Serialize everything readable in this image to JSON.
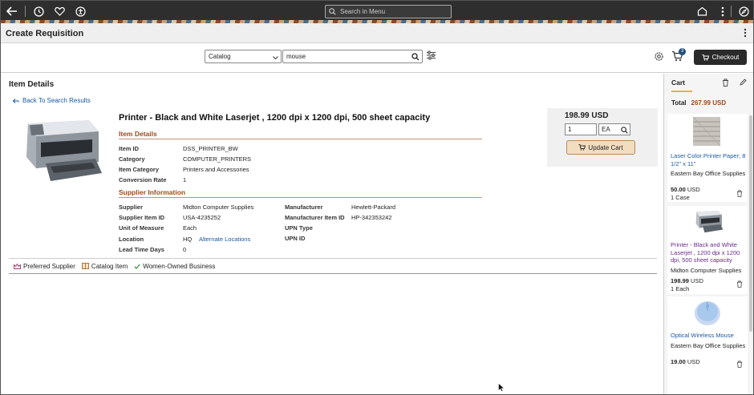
{
  "topbar": {
    "search_placeholder": "Search in Menu",
    "icons": [
      "back-arrow-icon",
      "history-icon",
      "favorite-heart-icon",
      "accessibility-icon",
      "home-icon",
      "more-vertical-icon",
      "navigator-compass-icon"
    ]
  },
  "titlebar": {
    "title": "Create Requisition"
  },
  "search": {
    "catalog_value": "Catalog",
    "query": "mouse",
    "cart_count": "3",
    "checkout_label": "Checkout"
  },
  "item": {
    "heading": "Item Details",
    "back_link": "Back To Search Results",
    "title": "Printer - Black and White Laserjet , 1200 dpi x 1200 dpi, 500 sheet capacity",
    "details_heading": "Item Details",
    "details": [
      {
        "label": "Item ID",
        "value": "DSS_PRINTER_BW"
      },
      {
        "label": "Category",
        "value": "COMPUTER_PRINTERS"
      },
      {
        "label": "Item Category",
        "value": "Printers and Accessories"
      },
      {
        "label": "Conversion Rate",
        "value": "1"
      }
    ],
    "supplier_heading": "Supplier Information",
    "supplier_left": [
      {
        "label": "Supplier",
        "value": "Midton Computer Supplies"
      },
      {
        "label": "Supplier Item ID",
        "value": "USA-4235252"
      },
      {
        "label": "Unit of Measure",
        "value": "Each"
      },
      {
        "label": "Location",
        "value": "HQ"
      },
      {
        "label": "Lead Time Days",
        "value": "0"
      }
    ],
    "alternate_locations": "Alternate Locations",
    "supplier_right": [
      {
        "label": "Manufacturer",
        "value": "Hewlett-Packard"
      },
      {
        "label": "Manufacturer Item ID",
        "value": "HP-342353242"
      },
      {
        "label": "UPN Type",
        "value": ""
      },
      {
        "label": "UPN ID",
        "value": ""
      }
    ],
    "price": "198.99 USD",
    "qty": "1",
    "uom": "EA",
    "update_label": "Update Cart",
    "legend": [
      "Preferred Supplier",
      "Catalog Item",
      "Women-Owned Business"
    ]
  },
  "cart": {
    "title": "Cart",
    "total_label": "Total",
    "total_amount": "267.99 USD",
    "items": [
      {
        "name": "Laser Color Printer Paper; 8 1/2\" x 11\"",
        "supplier": "Eastern Bay Office Supplies",
        "price": "50.00",
        "currency": "USD",
        "qty": "1 Case"
      },
      {
        "name": "Printer - Black and White Laserjet , 1200 dpi x 1200 dpi, 500 sheet capacity",
        "supplier": "Midton Computer Supplies",
        "price": "198.99",
        "currency": "USD",
        "qty": "1 Each"
      },
      {
        "name": "Optical Wireless Mouse",
        "supplier": "Eastern Bay Office Supplies",
        "price": "19.00",
        "currency": "USD",
        "qty": ""
      }
    ]
  },
  "colors": {
    "accent_brown": "#9a4a1f",
    "link_blue": "#1a5aa0",
    "update_button": "#f3ddbf",
    "topbar": "#2e2e2e"
  }
}
